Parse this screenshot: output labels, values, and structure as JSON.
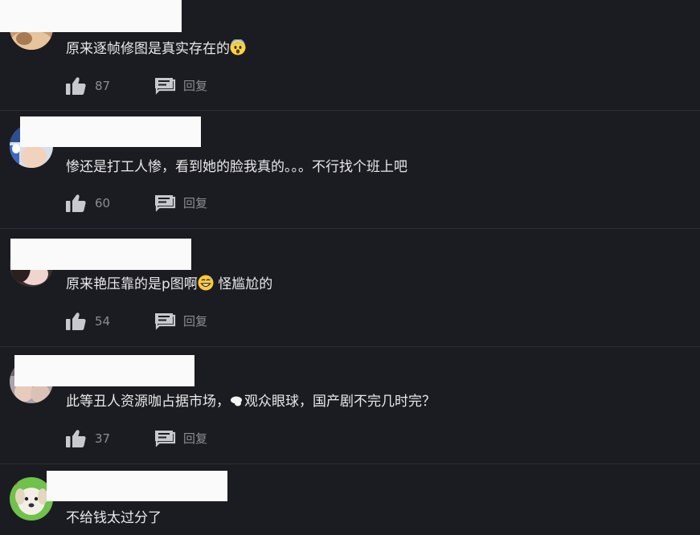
{
  "comments": [
    {
      "text": "原来逐帧修图是真实存在的",
      "emoji": "fearful-face",
      "likes": "87",
      "reply_label": "回复"
    },
    {
      "text": "惨还是打工人惨，看到她的脸我真的。。。不行找个班上吧",
      "likes": "60",
      "reply_label": "回复"
    },
    {
      "text_before": "原来艳压靠的是p图啊",
      "emoji": "grinning-sweat-face",
      "text_after": " 怪尴尬的",
      "likes": "54",
      "reply_label": "回复"
    },
    {
      "text_before": "此等丑人资源咖占据市场，",
      "text_after": "观众眼球，国产剧不完几时完？",
      "likes": "37",
      "reply_label": "回复"
    },
    {
      "text": "不给钱太过分了"
    }
  ],
  "colors": {
    "background": "#1b1c21",
    "text": "#e8e8ea",
    "meta": "#8c8d93",
    "icon": "#c8c9ce",
    "divider": "#2c2d33"
  },
  "icons": {
    "like": "thumbs-up-icon",
    "reply": "comment-bubble-icon"
  }
}
